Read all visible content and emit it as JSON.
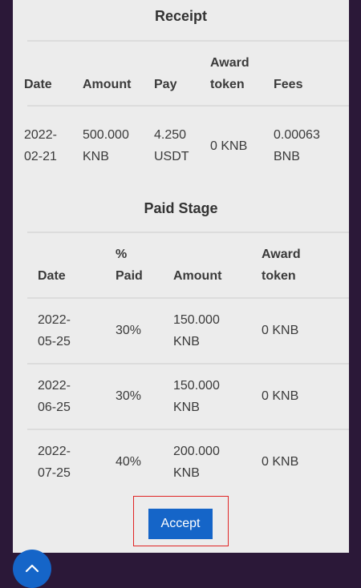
{
  "receipt": {
    "title": "Receipt",
    "headers": [
      "Date",
      "Amount",
      "Pay",
      "Award\ntoken",
      "Fees"
    ],
    "row": [
      "2022-\n02-21",
      "500.000\nKNB",
      "4.250\nUSDT",
      "0 KNB",
      "0.00063\nBNB"
    ]
  },
  "paid_stage": {
    "title": "Paid Stage",
    "headers": [
      "Date",
      "%\nPaid",
      "Amount",
      "Award\ntoken"
    ],
    "rows": [
      [
        "2022-\n05-25",
        "30%",
        "150.000\nKNB",
        "0 KNB"
      ],
      [
        "2022-\n06-25",
        "30%",
        "150.000\nKNB",
        "0 KNB"
      ],
      [
        "2022-\n07-25",
        "40%",
        "200.000\nKNB",
        "0 KNB"
      ]
    ]
  },
  "accept_label": "Accept",
  "scroll_top_icon": "chevron-up-icon"
}
